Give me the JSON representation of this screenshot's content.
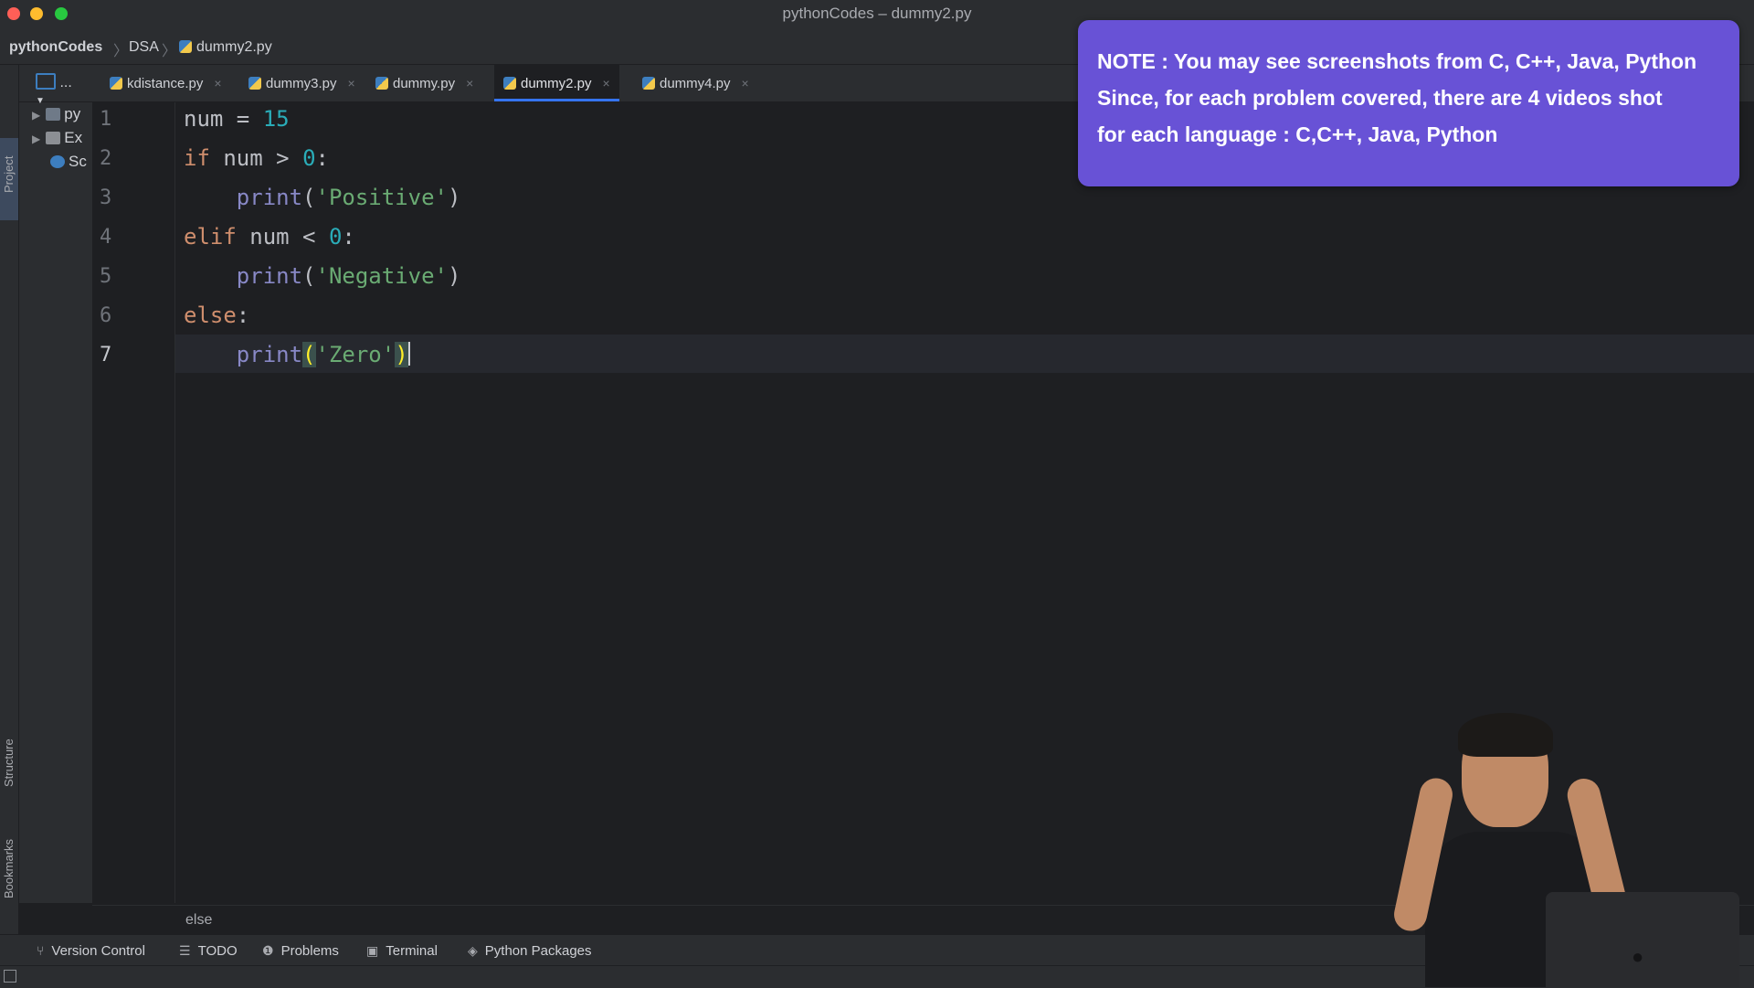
{
  "window": {
    "title": "pythonCodes – dummy2.py"
  },
  "breadcrumb": {
    "project": "pythonCodes",
    "folder": "DSA",
    "file": "dummy2.py"
  },
  "stripe": {
    "project_label": "Project",
    "structure_label": "Structure",
    "bookmarks_label": "Bookmarks"
  },
  "project_tree": {
    "items": [
      {
        "label": "py",
        "icon": "folder-icon"
      },
      {
        "label": "Ex",
        "icon": "library-icon"
      },
      {
        "label": "Sc",
        "icon": "scratches-icon"
      }
    ]
  },
  "tabs": {
    "menu_label": "...",
    "items": [
      {
        "label": "kdistance.py",
        "active": false
      },
      {
        "label": "dummy3.py",
        "active": false
      },
      {
        "label": "dummy.py",
        "active": false
      },
      {
        "label": "dummy2.py",
        "active": true
      },
      {
        "label": "dummy4.py",
        "active": false
      }
    ],
    "close_glyph": "×"
  },
  "editor": {
    "line_numbers": [
      "1",
      "2",
      "3",
      "4",
      "5",
      "6",
      "7"
    ],
    "current_line": 7,
    "code": {
      "l1": {
        "name": "num",
        "eq": " = ",
        "value": "15"
      },
      "l2": {
        "kw": "if",
        "rest": " num > ",
        "value": "0",
        "colon": ":"
      },
      "l3": {
        "indent": "    ",
        "fn": "print",
        "open": "(",
        "str": "'Positive'",
        "close": ")"
      },
      "l4": {
        "kw": "elif",
        "rest": " num < ",
        "value": "0",
        "colon": ":"
      },
      "l5": {
        "indent": "    ",
        "fn": "print",
        "open": "(",
        "str": "'Negative'",
        "close": ")"
      },
      "l6": {
        "kw": "else",
        "colon": ":"
      },
      "l7": {
        "indent": "    ",
        "fn": "print",
        "open": "(",
        "str": "'Zero'",
        "close": ")"
      }
    },
    "footer_breadcrumb": "else"
  },
  "bottom_tools": {
    "version_control": "Version Control",
    "todo": "TODO",
    "problems": "Problems",
    "terminal": "Terminal",
    "python_packages": "Python Packages"
  },
  "note": {
    "line1": "NOTE : You may see screenshots from C, C++, Java, Python",
    "line2": "Since, for each problem covered, there are 4 videos shot",
    "line3": "for each language : C,C++, Java, Python",
    "background": "#6852d6"
  },
  "colors": {
    "keyword": "#cf8e6d",
    "number": "#2aacb8",
    "string": "#6aab73",
    "builtin": "#8888c6",
    "tab_active_underline": "#3574f0"
  }
}
